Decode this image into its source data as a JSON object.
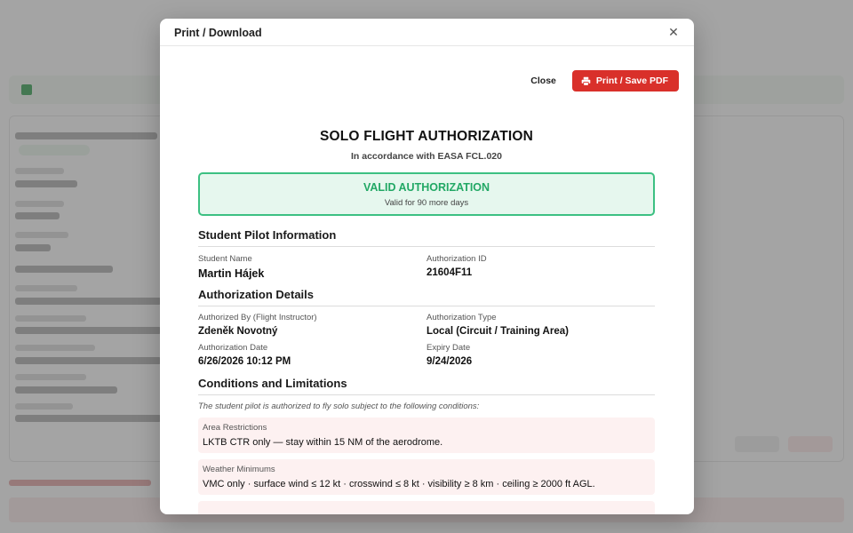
{
  "modal": {
    "title": "Print / Download",
    "close_label": "Close",
    "print_label": "Print / Save PDF"
  },
  "document": {
    "title": "SOLO FLIGHT AUTHORIZATION",
    "subtitle": "In accordance with EASA FCL.020",
    "status": {
      "heading": "VALID AUTHORIZATION",
      "detail": "Valid for 90 more days"
    },
    "student_section": {
      "title": "Student Pilot Information",
      "fields": [
        {
          "label": "Student Name",
          "value": "Martin Hájek"
        },
        {
          "label": "Authorization ID",
          "value": "21604F11"
        }
      ]
    },
    "details_section": {
      "title": "Authorization Details",
      "fields": [
        {
          "label": "Authorized By (Flight Instructor)",
          "value": "Zdeněk Novotný"
        },
        {
          "label": "Authorization Type",
          "value": "Local (Circuit / Training Area)"
        },
        {
          "label": "Authorization Date",
          "value": "6/26/2026 10:12 PM"
        },
        {
          "label": "Expiry Date",
          "value": "9/24/2026"
        }
      ]
    },
    "conditions_section": {
      "title": "Conditions and Limitations",
      "intro": "The student pilot is authorized to fly solo subject to the following conditions:",
      "items": [
        {
          "label": "Area Restrictions",
          "text": "LKTB CTR only — stay within 15 NM of the aerodrome."
        },
        {
          "label": "Weather Minimums",
          "text": "VMC only · surface wind ≤ 12 kt · crosswind ≤ 8 kt · visibility ≥ 8 km · ceiling ≥ 2000 ft AGL."
        }
      ]
    }
  },
  "colors": {
    "accent_red": "#d9302a",
    "valid_green": "#22a865",
    "valid_bg": "#e6f7ee"
  }
}
